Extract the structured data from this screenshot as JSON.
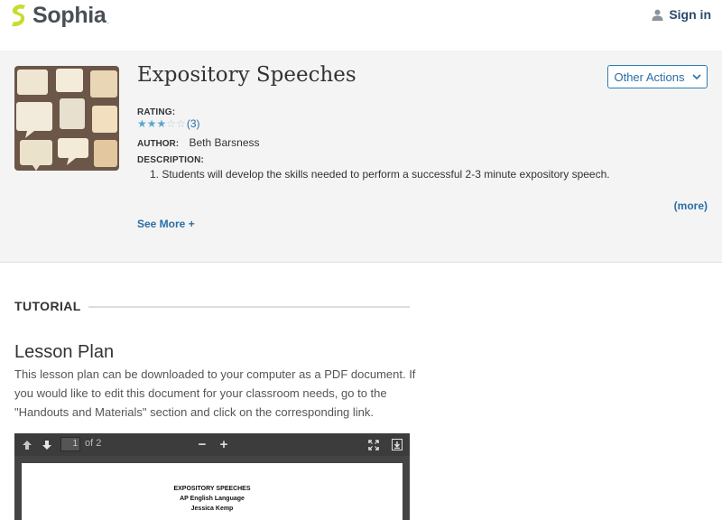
{
  "header": {
    "brand": "Sophia",
    "brand_mark": ".",
    "signin_label": "Sign in",
    "signin_icon": "user-icon"
  },
  "hero": {
    "title": "Expository Speeches",
    "other_actions_label": "Other Actions",
    "rating_label": "RATING:",
    "rating_value": 2.5,
    "rating_max": 5,
    "rating_count": "(3)",
    "author_label": "AUTHOR:",
    "author": "Beth Barsness",
    "description_label": "DESCRIPTION:",
    "description": "1. Students will develop the skills needed to perform a successful 2-3 minute expository speech.",
    "more_label": "(more)",
    "see_more_label": "See More +"
  },
  "tutorial": {
    "heading": "TUTORIAL",
    "lesson_title": "Lesson Plan",
    "lesson_body": "This lesson plan can be downloaded to your computer as a PDF document. If you would like to edit this document for your classroom needs, go to the \"Handouts and Materials\" section and click on the corresponding link."
  },
  "viewer": {
    "page_current": "1",
    "page_total": "of 2",
    "zoom_out": "−",
    "zoom_in": "+",
    "doc_lines": [
      "EXPOSITORY SPEECHES",
      "AP English Language",
      "Jessica Kemp"
    ]
  },
  "colors": {
    "accent": "#2b6ea6",
    "brand_yellow": "#c9dc2e",
    "hero_bg": "#f4f4f4"
  }
}
